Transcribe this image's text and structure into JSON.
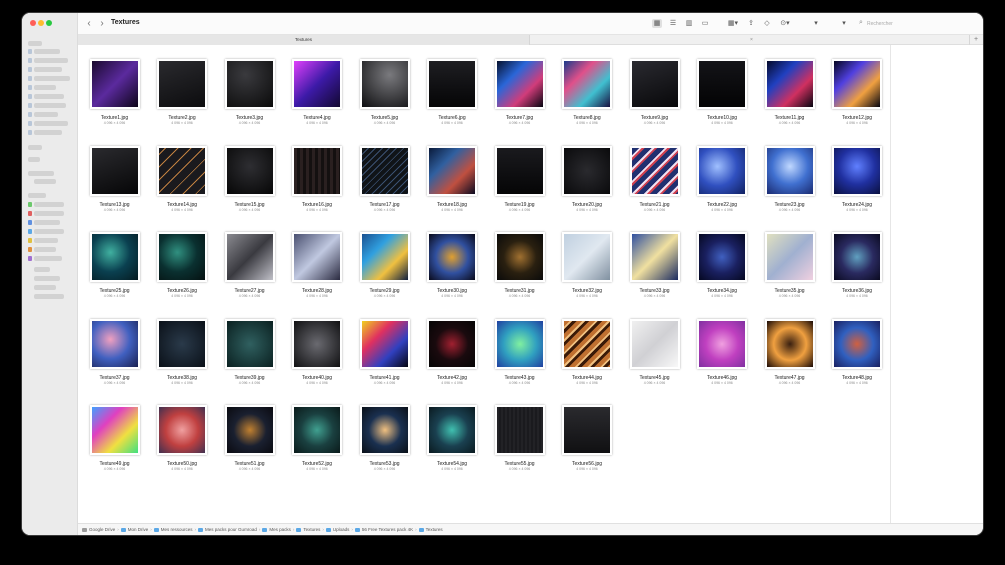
{
  "window": {
    "title": "Textures"
  },
  "toolbar": {
    "back": "‹",
    "forward": "›",
    "icons": [
      "grid-view-icon",
      "list-view-icon",
      "column-view-icon",
      "gallery-view-icon",
      "group-icon",
      "share-icon",
      "tag-icon",
      "action-icon",
      "chevron-down-icon",
      "chevron-down-icon"
    ]
  },
  "search": {
    "placeholder": "Rechercher"
  },
  "tabs": [
    {
      "label": "Textures"
    },
    {
      "label": ""
    }
  ],
  "files": [
    {
      "name": "Texture1.jpg",
      "dims": "4 096 × 4 096"
    },
    {
      "name": "Texture2.jpg",
      "dims": "4 096 × 4 096"
    },
    {
      "name": "Texture3.jpg",
      "dims": "4 096 × 4 096"
    },
    {
      "name": "Texture4.jpg",
      "dims": "4 096 × 4 096"
    },
    {
      "name": "Texture5.jpg",
      "dims": "4 096 × 4 096"
    },
    {
      "name": "Texture6.jpg",
      "dims": "4 096 × 4 096"
    },
    {
      "name": "Texture7.jpg",
      "dims": "4 096 × 4 096"
    },
    {
      "name": "Texture8.jpg",
      "dims": "4 096 × 4 096"
    },
    {
      "name": "Texture9.jpg",
      "dims": "4 096 × 4 096"
    },
    {
      "name": "Texture10.jpg",
      "dims": "4 096 × 4 096"
    },
    {
      "name": "Texture11.jpg",
      "dims": "4 096 × 4 096"
    },
    {
      "name": "Texture12.jpg",
      "dims": "4 096 × 4 096"
    },
    {
      "name": "Texture13.jpg",
      "dims": "4 096 × 4 096"
    },
    {
      "name": "Texture14.jpg",
      "dims": "4 096 × 4 096"
    },
    {
      "name": "Texture15.jpg",
      "dims": "4 096 × 4 096"
    },
    {
      "name": "Texture16.jpg",
      "dims": "4 096 × 4 096"
    },
    {
      "name": "Texture17.jpg",
      "dims": "4 096 × 4 096"
    },
    {
      "name": "Texture18.jpg",
      "dims": "4 096 × 4 096"
    },
    {
      "name": "Texture19.jpg",
      "dims": "4 096 × 4 096"
    },
    {
      "name": "Texture20.jpg",
      "dims": "4 096 × 4 096"
    },
    {
      "name": "Texture21.jpg",
      "dims": "4 096 × 4 096"
    },
    {
      "name": "Texture22.jpg",
      "dims": "4 096 × 4 096"
    },
    {
      "name": "Texture23.jpg",
      "dims": "4 096 × 4 096"
    },
    {
      "name": "Texture24.jpg",
      "dims": "4 096 × 4 096"
    },
    {
      "name": "Texture25.jpg",
      "dims": "4 096 × 4 096"
    },
    {
      "name": "Texture26.jpg",
      "dims": "4 096 × 4 096"
    },
    {
      "name": "Texture27.jpg",
      "dims": "4 096 × 4 096"
    },
    {
      "name": "Texture28.jpg",
      "dims": "4 096 × 4 096"
    },
    {
      "name": "Texture29.jpg",
      "dims": "4 096 × 4 096"
    },
    {
      "name": "Texture30.jpg",
      "dims": "4 096 × 4 096"
    },
    {
      "name": "Texture31.jpg",
      "dims": "4 096 × 4 096"
    },
    {
      "name": "Texture32.jpg",
      "dims": "4 096 × 4 096"
    },
    {
      "name": "Texture33.jpg",
      "dims": "4 096 × 4 096"
    },
    {
      "name": "Texture34.jpg",
      "dims": "4 096 × 4 096"
    },
    {
      "name": "Texture35.jpg",
      "dims": "4 096 × 4 096"
    },
    {
      "name": "Texture36.jpg",
      "dims": "4 096 × 4 096"
    },
    {
      "name": "Texture37.jpg",
      "dims": "4 096 × 4 096"
    },
    {
      "name": "Texture38.jpg",
      "dims": "4 096 × 4 096"
    },
    {
      "name": "Texture39.jpg",
      "dims": "4 096 × 4 096"
    },
    {
      "name": "Texture40.jpg",
      "dims": "4 096 × 4 096"
    },
    {
      "name": "Texture41.jpg",
      "dims": "4 096 × 4 096"
    },
    {
      "name": "Texture42.jpg",
      "dims": "4 096 × 4 096"
    },
    {
      "name": "Texture43.jpg",
      "dims": "4 096 × 4 096"
    },
    {
      "name": "Texture44.jpg",
      "dims": "4 096 × 4 096"
    },
    {
      "name": "Texture45.jpg",
      "dims": "4 096 × 4 096"
    },
    {
      "name": "Texture46.jpg",
      "dims": "4 096 × 4 096"
    },
    {
      "name": "Texture47.jpg",
      "dims": "4 096 × 4 096"
    },
    {
      "name": "Texture48.jpg",
      "dims": "4 096 × 4 096"
    },
    {
      "name": "Texture49.jpg",
      "dims": "4 096 × 4 096"
    },
    {
      "name": "Texture50.jpg",
      "dims": "4 096 × 4 096"
    },
    {
      "name": "Texture51.jpg",
      "dims": "4 096 × 4 096"
    },
    {
      "name": "Texture52.jpg",
      "dims": "4 096 × 4 096"
    },
    {
      "name": "Texture53.jpg",
      "dims": "4 096 × 4 096"
    },
    {
      "name": "Texture54.jpg",
      "dims": "4 096 × 4 096"
    },
    {
      "name": "Texture55.jpg",
      "dims": "4 096 × 4 096"
    },
    {
      "name": "Texture56.jpg",
      "dims": "4 096 × 4 096"
    }
  ],
  "thumb_colors": [
    "linear-gradient(135deg,#1a0a2e,#5b2a9e,#0d0518)",
    "linear-gradient(160deg,#2a2a2e,#0c0c0e)",
    "radial-gradient(circle at 40% 30%,#3a3a3e,#0a0a0a)",
    "linear-gradient(135deg,#e040fb,#3d1aa8,#120830)",
    "radial-gradient(circle at 60% 30%,#7a7a7e,#0e0e10)",
    "linear-gradient(180deg,#1e1e22,#050506)",
    "linear-gradient(135deg,#07122e,#2a66d8,#d13c7a,#050510)",
    "linear-gradient(135deg,#1a3a8a,#e0508a,#40c0d0,#181040)",
    "linear-gradient(160deg,#2a2a30,#08080a)",
    "linear-gradient(180deg,#141418,#030304)",
    "linear-gradient(135deg,#050a2a,#2040c0,#d03060,#050510)",
    "linear-gradient(135deg,#050520,#5040e0,#f0a040,#050510)",
    "linear-gradient(160deg,#2a2a2e,#060607)",
    "repeating-linear-gradient(135deg,#1a1a1e 0 4px,#c08040 4px 5px,#1a1a1e 5px 9px)",
    "radial-gradient(circle at 50% 40%,#2e2e32,#060606)",
    "repeating-linear-gradient(90deg,#2a2020 0 3px,#141010 3px 6px)",
    "repeating-linear-gradient(135deg,#101418 0 4px,#3a5070 4px 5px)",
    "linear-gradient(135deg,#0a1a3a,#3060a0,#c05040,#0a0a20)",
    "linear-gradient(180deg,#1a1a1e,#050506)",
    "radial-gradient(circle at 50% 50%,#2a2a2e,#0a0a0c)",
    "repeating-linear-gradient(135deg,#203070 0 5px,#f0e0f0 5px 7px,#d04050 7px 9px)",
    "radial-gradient(circle at 40% 40%,#a0c0ff,#3050c0,#102060)",
    "radial-gradient(circle at 50% 40%,#c0d8ff,#4070d0,#1a2a70)",
    "radial-gradient(circle at 50% 40%,#6080ff,#2030a0,#0a1040)",
    "radial-gradient(circle at 40% 40%,#40b0a0,#0a4050,#051a20)",
    "radial-gradient(circle at 40% 40%,#309080,#0a3030,#051010)",
    "linear-gradient(135deg,#8a8a90,#3a3a40,#c0c0c8)",
    "linear-gradient(135deg,#4a5070,#c0c8e0,#2a2a40)",
    "linear-gradient(135deg,#1a5090,#30a0e0,#f0c040,#102040)",
    "radial-gradient(circle at 50% 50%,#e0a030,#3050a0,#0a0a1a)",
    "radial-gradient(circle at 50% 50%,#a07030,#2a2010,#0a0a0a)",
    "linear-gradient(135deg,#c0d0e0,#e0e8f0,#8090a0)",
    "linear-gradient(135deg,#3050a0,#f0e0a0,#1a2a60)",
    "radial-gradient(circle at 50% 50%,#4060c0,#1a2060,#050820)",
    "linear-gradient(135deg,#e0e0c0,#a0b0d0,#f0d0e0)",
    "radial-gradient(circle at 50% 50%,#60a0c0,#2a2a60,#0a0a20)",
    "radial-gradient(circle at 40% 40%,#f0a0c0,#4060c0,#1a2050)",
    "radial-gradient(circle at 50% 50%,#2a3a4a,#0a1018)",
    "radial-gradient(circle at 50% 50%,#306060,#0a2020)",
    "radial-gradient(circle at 50% 50%,#6a6a70,#101012)",
    "linear-gradient(135deg,#f0d020,#e03060,#3040c0,#050510)",
    "radial-gradient(circle at 50% 50%,#a02030,#1a0a0e,#050505)",
    "radial-gradient(circle at 50% 50%,#80f0a0,#30a0c0,#2040a0)",
    "repeating-linear-gradient(135deg,#c07030 0 4px,#f0c080 4px 6px,#3a1a08 6px 9px)",
    "linear-gradient(135deg,#f0f0f0,#d0d0d4,#f8f8f8)",
    "radial-gradient(circle at 50% 50%,#f0a0e0,#c040c0,#8030a0)",
    "radial-gradient(circle at 50% 50%,#3a2010,#f0a040,#1a0a05)",
    "radial-gradient(circle at 50% 50%,#d06040,#3060c0,#1a2060)",
    "linear-gradient(135deg,#40a0ff,#e040c0,#f0e040,#40e080)",
    "radial-gradient(circle at 50% 50%,#f0a0a0,#c04040,#403050)",
    "radial-gradient(circle at 50% 50%,#c08030,#1a2030,#0a0a10)",
    "radial-gradient(circle at 50% 50%,#40a090,#1a4040,#0a1a1a)",
    "radial-gradient(circle at 50% 50%,#f0c080,#1a3050,#0a1018)",
    "radial-gradient(circle at 50% 50%,#40c0b0,#1a4050,#0a1a20)",
    "repeating-linear-gradient(90deg,#222226 0 2px,#1a1a1e 2px 4px)",
    "linear-gradient(180deg,#2a2a2e,#101012)"
  ],
  "pathbar": [
    "Google Drive",
    "Mon Drive",
    "Mes ressources",
    "Mes packs pour Gumroad",
    "Mes packs",
    "Textures",
    "Uploads",
    "56 Free Textures pack 4K",
    "Textures"
  ]
}
